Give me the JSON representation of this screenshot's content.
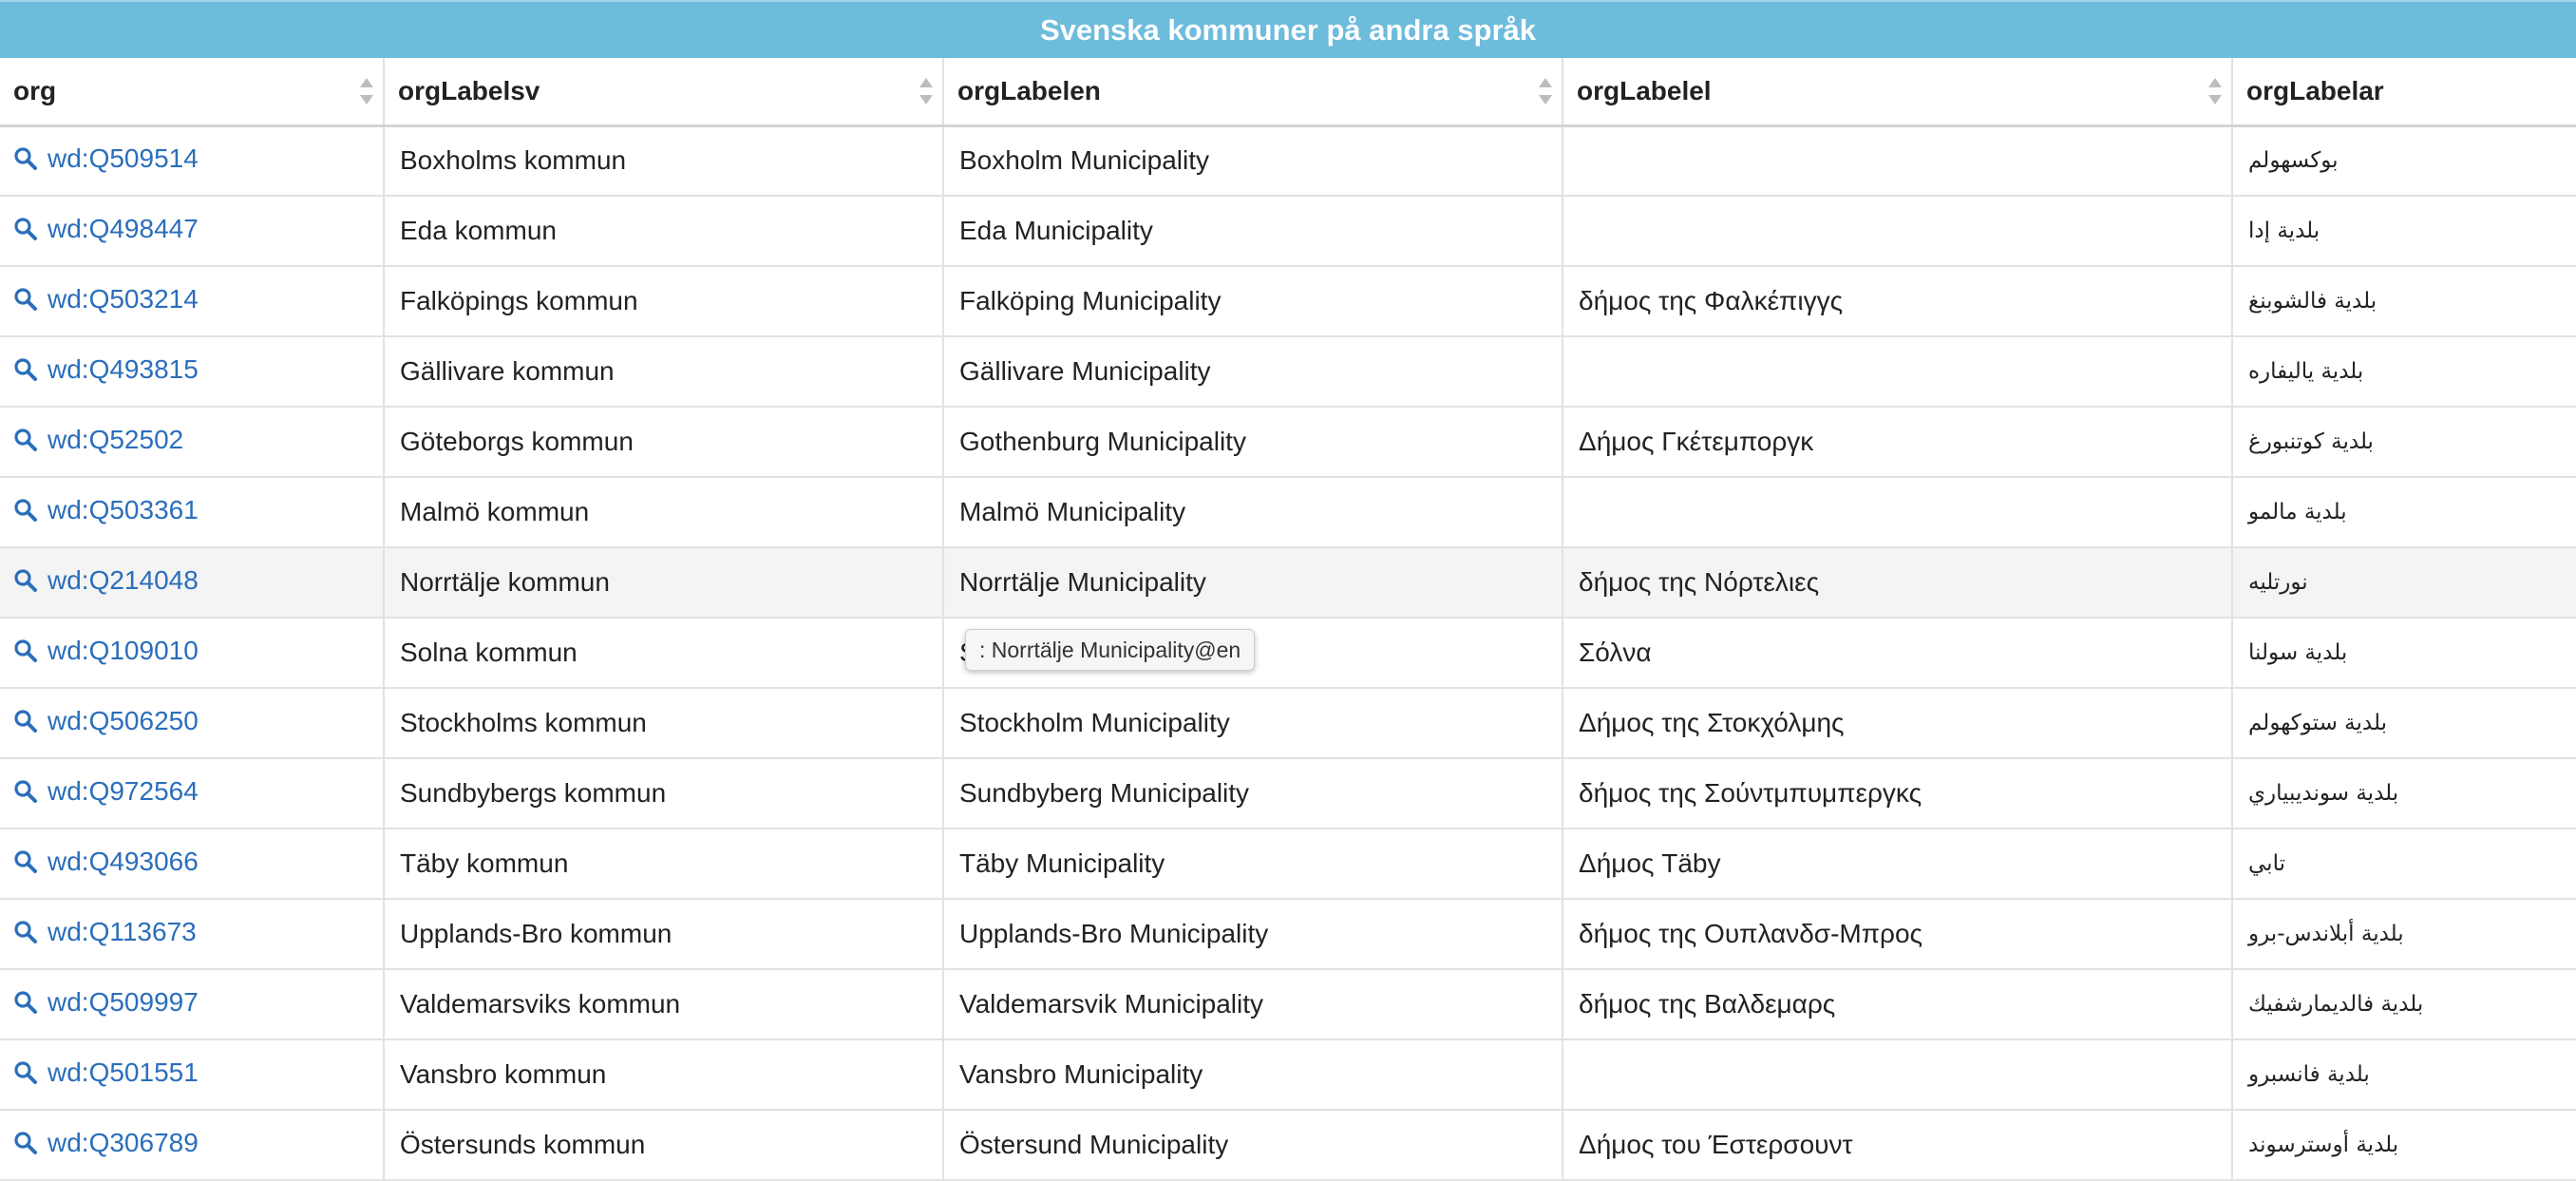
{
  "title": "Svenska kommuner på andra språk",
  "columns": [
    "org",
    "orgLabelsv",
    "orgLabelen",
    "orgLabelel",
    "orgLabelar"
  ],
  "rows": [
    {
      "org": "wd:Q509514",
      "sv": "Boxholms kommun",
      "en": "Boxholm Municipality",
      "el": "",
      "ar": "بوكسهولم"
    },
    {
      "org": "wd:Q498447",
      "sv": "Eda kommun",
      "en": "Eda Municipality",
      "el": "",
      "ar": "بلدية إدا"
    },
    {
      "org": "wd:Q503214",
      "sv": "Falköpings kommun",
      "en": "Falköping Municipality",
      "el": "δήμος της Φαλκέπιγγς",
      "ar": "بلدية فالشوبنغ"
    },
    {
      "org": "wd:Q493815",
      "sv": "Gällivare kommun",
      "en": "Gällivare Municipality",
      "el": "",
      "ar": "بلدية ياليفاره"
    },
    {
      "org": "wd:Q52502",
      "sv": "Göteborgs kommun",
      "en": "Gothenburg Municipality",
      "el": "Δήμος Γκέτεμποργκ",
      "ar": "بلدية كوتنبورغ"
    },
    {
      "org": "wd:Q503361",
      "sv": "Malmö kommun",
      "en": "Malmö Municipality",
      "el": "",
      "ar": "بلدية مالمو"
    },
    {
      "org": "wd:Q214048",
      "sv": "Norrtälje kommun",
      "en": "Norrtälje Municipality",
      "el": "δήμος της Νόρτελιες",
      "ar": "نورتليه"
    },
    {
      "org": "wd:Q109010",
      "sv": "Solna kommun",
      "en": "Solna Municipality",
      "el": "Σόλνα",
      "ar": "بلدية سولنا"
    },
    {
      "org": "wd:Q506250",
      "sv": "Stockholms kommun",
      "en": "Stockholm Municipality",
      "el": "Δήμος της Στοκχόλμης",
      "ar": "بلدية ستوكهولم"
    },
    {
      "org": "wd:Q972564",
      "sv": "Sundbybergs kommun",
      "en": "Sundbyberg Municipality",
      "el": "δήμος της Σούντμπυμπεργκς",
      "ar": "بلدية سونديبياري"
    },
    {
      "org": "wd:Q493066",
      "sv": "Täby kommun",
      "en": "Täby Municipality",
      "el": "Δήμος Täby",
      "ar": "تابي"
    },
    {
      "org": "wd:Q113673",
      "sv": "Upplands-Bro kommun",
      "en": "Upplands-Bro Municipality",
      "el": "δήμος της Ουπλανδσ-Μπρος",
      "ar": "بلدية أبلاندس-برو"
    },
    {
      "org": "wd:Q509997",
      "sv": "Valdemarsviks kommun",
      "en": "Valdemarsvik Municipality",
      "el": "δήμος της Βαλδεμαρς",
      "ar": "بلدية فالديمارشفيك"
    },
    {
      "org": "wd:Q501551",
      "sv": "Vansbro kommun",
      "en": "Vansbro Municipality",
      "el": "",
      "ar": "بلدية فانسبرو"
    },
    {
      "org": "wd:Q306789",
      "sv": "Östersunds kommun",
      "en": "Östersund Municipality",
      "el": "Δήμος του Έστερσουντ",
      "ar": "بلدية أوسترسوند"
    }
  ],
  "hovered_row": 6,
  "tooltip": ": Norrtälje Municipality@en",
  "colors": {
    "title_bar": "#6dbcdc",
    "link": "#2a6ebb"
  }
}
